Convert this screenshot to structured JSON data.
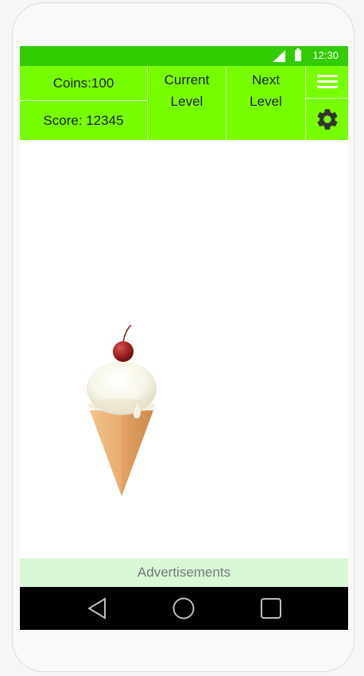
{
  "status_bar": {
    "time": "12:30",
    "signal_icon": "signal-icon",
    "battery_icon": "battery-icon"
  },
  "hud": {
    "coins": "Coins:100",
    "score": "Score: 12345",
    "current_level": "Current Level",
    "next_level": "Next Level",
    "menu_icon": "hamburger-menu-icon",
    "settings_icon": "gear-icon"
  },
  "game": {
    "sprite": "ice-cream-cone-with-cherry"
  },
  "ad": {
    "label": "Advertisements"
  },
  "nav": {
    "back_icon": "back-triangle-icon",
    "home_icon": "home-circle-icon",
    "recent_icon": "recent-square-icon"
  },
  "colors": {
    "status_bar": "#33cc00",
    "hud_background": "#77ff00",
    "ad_background": "#daf7d8",
    "nav_background": "#000000"
  }
}
